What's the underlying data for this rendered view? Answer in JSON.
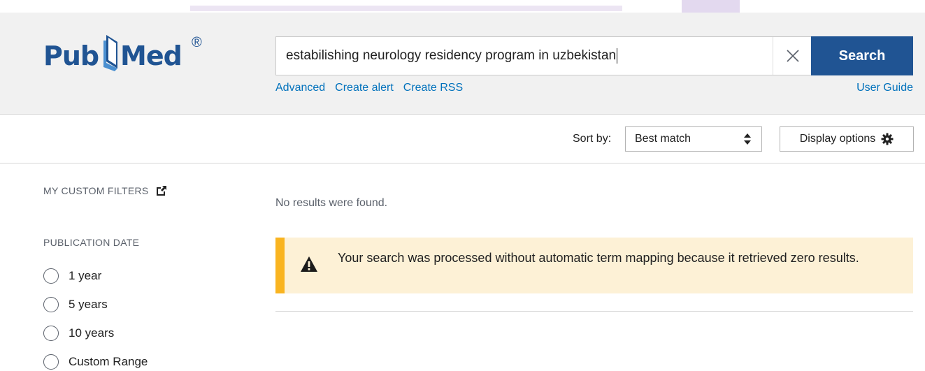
{
  "header": {
    "logo": {
      "text_pub": "Pub",
      "text_med": "Med",
      "registered": "®"
    },
    "search": {
      "query": "estabilishing neurology residency program in uzbekistan",
      "button_label": "Search"
    },
    "links": [
      "Advanced",
      "Create alert",
      "Create RSS"
    ],
    "user_guide": "User Guide"
  },
  "toolbar": {
    "sort_label": "Sort by:",
    "sort_value": "Best match",
    "display_options_label": "Display options"
  },
  "sidebar": {
    "custom_filters_heading": "MY CUSTOM FILTERS",
    "publication_date_heading": "PUBLICATION DATE",
    "date_options": [
      "1 year",
      "5 years",
      "10 years",
      "Custom Range"
    ]
  },
  "main": {
    "no_results": "No results were found.",
    "alert_message": "Your search was processed without automatic term mapping because it retrieved zero results."
  },
  "colors": {
    "brand_blue": "#205493",
    "link_blue": "#0071bc",
    "alert_bg": "#fdf1d6",
    "alert_accent": "#f9b420"
  }
}
